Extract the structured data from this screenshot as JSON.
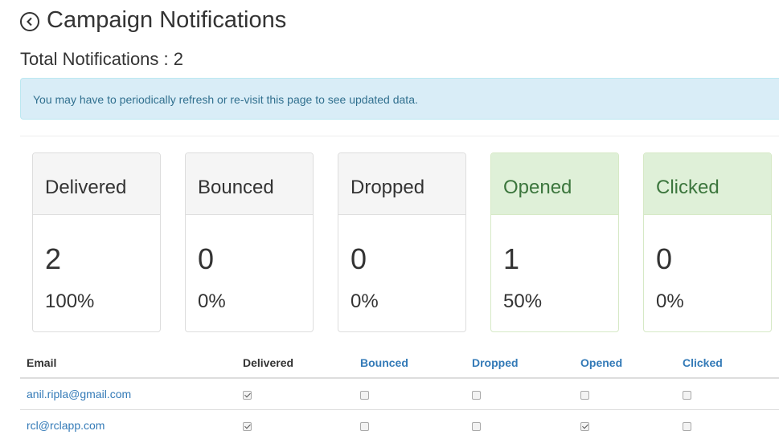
{
  "header": {
    "title": "Campaign Notifications",
    "total_label": "Total Notifications : 2"
  },
  "alert": {
    "message": "You may have to periodically refresh or re-visit this page to see updated data."
  },
  "stats": [
    {
      "label": "Delivered",
      "count": "2",
      "percent": "100%",
      "style": "default"
    },
    {
      "label": "Bounced",
      "count": "0",
      "percent": "0%",
      "style": "default"
    },
    {
      "label": "Dropped",
      "count": "0",
      "percent": "0%",
      "style": "default"
    },
    {
      "label": "Opened",
      "count": "1",
      "percent": "50%",
      "style": "success"
    },
    {
      "label": "Clicked",
      "count": "0",
      "percent": "0%",
      "style": "success"
    }
  ],
  "table": {
    "headers": [
      "Email",
      "Delivered",
      "Bounced",
      "Dropped",
      "Opened",
      "Clicked"
    ],
    "rows": [
      {
        "email": "anil.ripla@gmail.com",
        "delivered": true,
        "bounced": false,
        "dropped": false,
        "opened": false,
        "clicked": false
      },
      {
        "email": "rcl@rclapp.com",
        "delivered": true,
        "bounced": false,
        "dropped": false,
        "opened": true,
        "clicked": false
      }
    ]
  },
  "colors": {
    "link": "#337ab7",
    "alert_bg": "#d9edf7",
    "alert_text": "#31708f",
    "success_bg": "#dff0d8",
    "success_text": "#3c763d"
  }
}
